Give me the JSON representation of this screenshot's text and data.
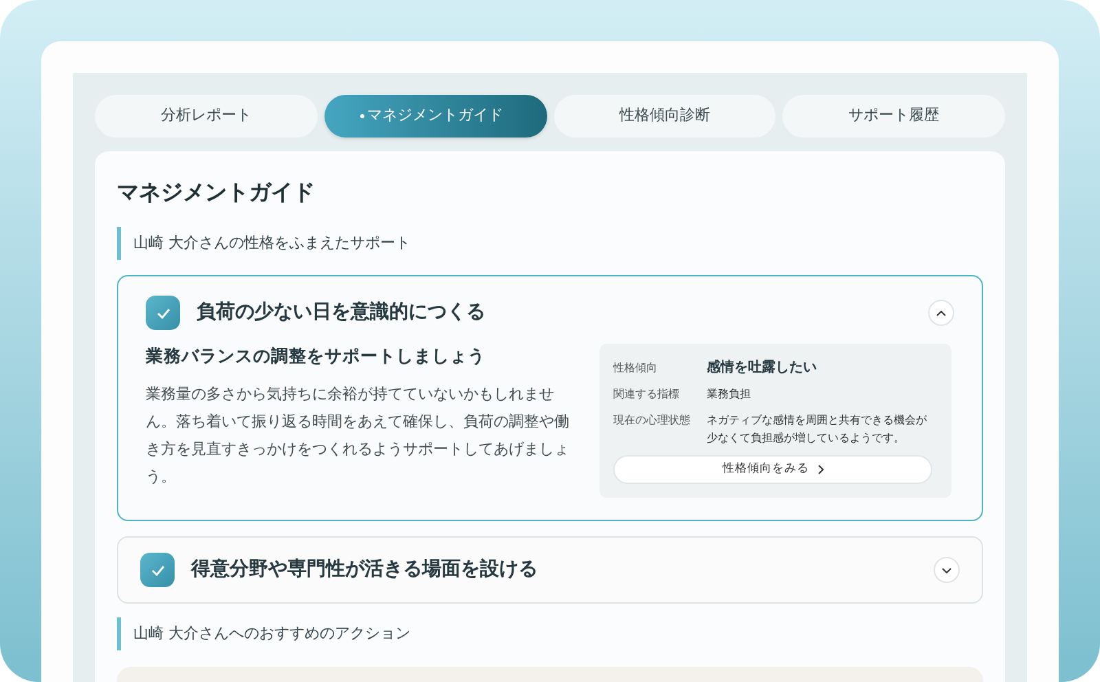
{
  "tabs": [
    {
      "label": "分析レポート",
      "selected": false
    },
    {
      "label": "マネジメントガイド",
      "selected": true
    },
    {
      "label": "性格傾向診断",
      "selected": false
    },
    {
      "label": "サポート履歴",
      "selected": false
    }
  ],
  "page_title": "マネジメントガイド",
  "support_heading": "山崎 大介さんの性格をふまえたサポート",
  "guides": [
    {
      "title": "負荷の少ない日を意識的につくる",
      "checked": true,
      "expanded": true,
      "subtitle": "業務バランスの調整をサポートしましょう",
      "body": "業務量の多さから気持ちに余裕が持てていないかもしれません。落ち着いて振り返る時間をあえて確保し、負荷の調整や働き方を見直すきっかけをつくれるようサポートしてあげましょう。",
      "details": [
        {
          "label": "性格傾向",
          "value": "感情を吐露したい",
          "emphasis": true
        },
        {
          "label": "関連する指標",
          "value": "業務負担",
          "emphasis": false
        },
        {
          "label": "現在の心理状態",
          "value": "ネガティブな感情を周囲と共有できる機会が少なくて負担感が増しているようです。",
          "emphasis": false
        }
      ],
      "link": "性格傾向をみる"
    },
    {
      "title": "得意分野や専門性が活きる場面を設ける",
      "checked": true,
      "expanded": false
    }
  ],
  "action_heading": "山崎 大介さんへのおすすめのアクション"
}
